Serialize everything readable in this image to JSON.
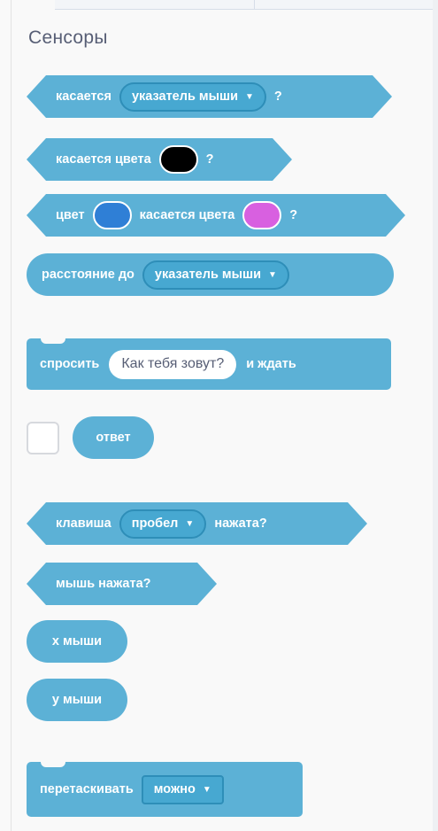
{
  "category": {
    "title": "Сенсоры"
  },
  "blocks": {
    "touching": {
      "label": "касается",
      "dropdown": "указатель мыши",
      "suffix": "?"
    },
    "touching_color": {
      "label": "касается цвета",
      "color": "#000000",
      "suffix": "?"
    },
    "color_touching": {
      "label_start": "цвет",
      "color1": "#2f7fd6",
      "label_mid": "касается цвета",
      "color2": "#d860e0",
      "suffix": "?"
    },
    "distance": {
      "label": "расстояние до",
      "dropdown": "указатель мыши"
    },
    "ask": {
      "label": "спросить",
      "input": "Как тебя зовут?",
      "suffix": "и ждать"
    },
    "answer": {
      "label": "ответ",
      "checked": false
    },
    "key_pressed": {
      "label": "клавиша",
      "dropdown": "пробел",
      "suffix": "нажата?"
    },
    "mouse_down": {
      "label": "мышь нажата?"
    },
    "mouse_x": {
      "label": "x мыши"
    },
    "mouse_y": {
      "label": "y мыши"
    },
    "drag_mode": {
      "label": "перетаскивать",
      "dropdown": "можно"
    }
  },
  "colors": {
    "sensing": "#5cb1d6",
    "sensing_dark": "#2e8eb8"
  }
}
